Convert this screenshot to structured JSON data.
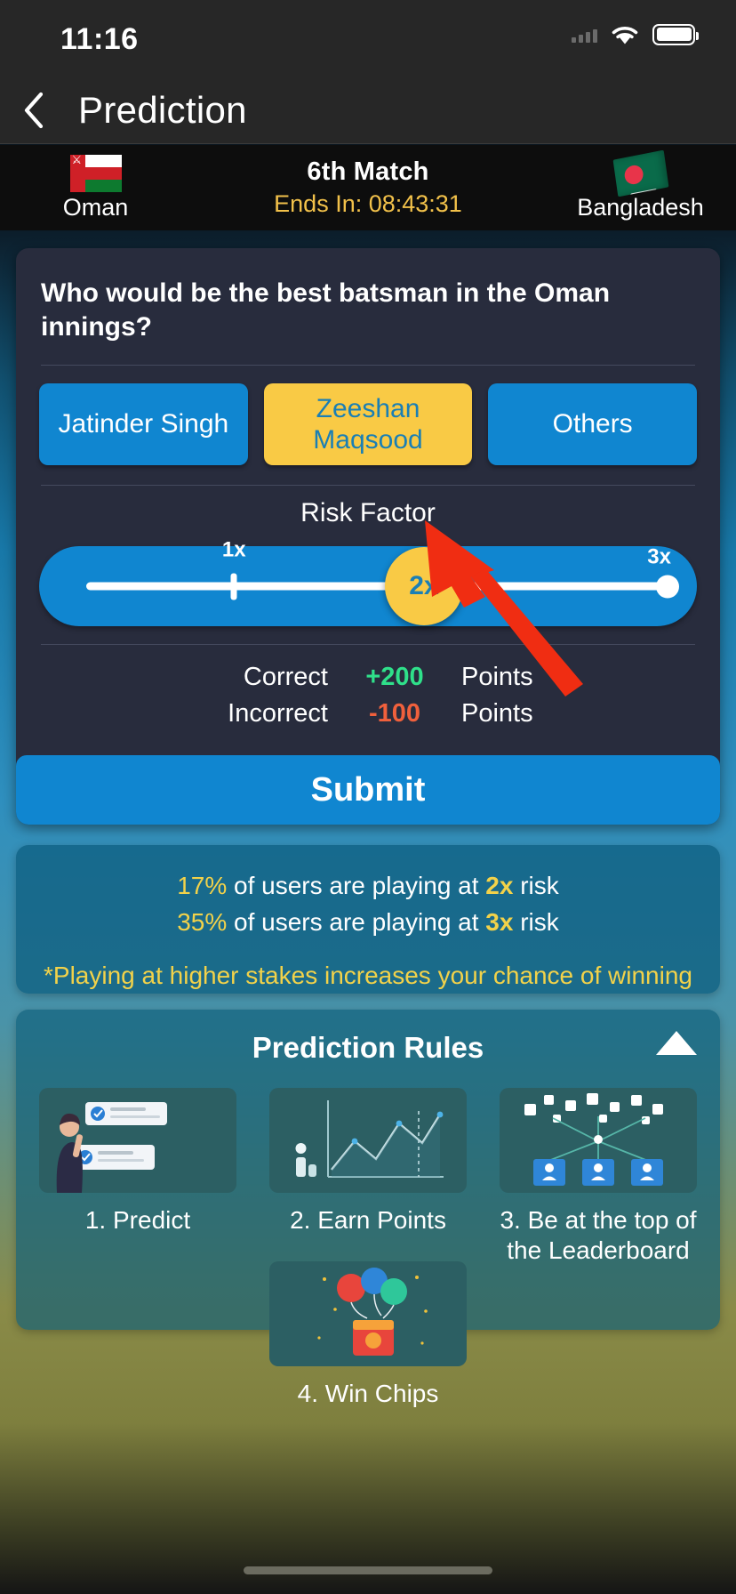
{
  "status_bar": {
    "time": "11:16",
    "wifi_icon": "wifi-icon",
    "battery_icon": "battery-icon",
    "signal_icon": "cellular-signal-icon"
  },
  "nav": {
    "back_icon": "chevron-left-icon",
    "title": "Prediction"
  },
  "match": {
    "team_left": "Oman",
    "team_left_flag": "oman-flag-icon",
    "team_right": "Bangladesh",
    "team_right_flag": "bangladesh-flag-icon",
    "title": "6th Match",
    "timer": "Ends In: 08:43:31"
  },
  "prediction": {
    "question": "Who would be the best batsman in the Oman innings?",
    "options": [
      {
        "label": "Jatinder Singh",
        "selected": false
      },
      {
        "label": "Zeeshan Maqsood",
        "selected": true
      },
      {
        "label": "Others",
        "selected": false
      }
    ],
    "risk_label": "Risk Factor",
    "slider": {
      "min_label": "1x",
      "max_label": "3x",
      "current_value": "2x"
    },
    "points": {
      "correct_label": "Correct",
      "correct_value": "+200",
      "correct_unit": "Points",
      "incorrect_label": "Incorrect",
      "incorrect_value": "-100",
      "incorrect_unit": "Points"
    },
    "submit_label": "Submit"
  },
  "stats": {
    "line1_pct": "17%",
    "line1_mid": " of users are playing at ",
    "line1_x": "2x",
    "line1_end": " risk",
    "line2_pct": "35%",
    "line2_mid": " of users are playing at ",
    "line2_x": "3x",
    "line2_end": " risk",
    "note": "*Playing at higher stakes increases your chance of winning"
  },
  "rules": {
    "title": "Prediction Rules",
    "toggle_icon": "triangle-up-icon",
    "items": [
      {
        "caption": "1. Predict",
        "art": "person-with-checklist-illustration"
      },
      {
        "caption": "2. Earn Points",
        "art": "line-chart-illustration"
      },
      {
        "caption": "3. Be at the top of the Leaderboard",
        "art": "leaderboard-network-illustration"
      },
      {
        "caption": "4. Win Chips",
        "art": "balloons-prize-illustration"
      }
    ]
  },
  "annotation": {
    "arrow_icon": "red-pointer-arrow",
    "target": "risk-factor-slider"
  },
  "colors": {
    "accent_blue": "#1086d0",
    "accent_yellow": "#f9ca45",
    "positive_green": "#2fe08a",
    "negative_red": "#f0603c",
    "timer_gold": "#f2c14a",
    "card_bg": "#282c3d"
  }
}
